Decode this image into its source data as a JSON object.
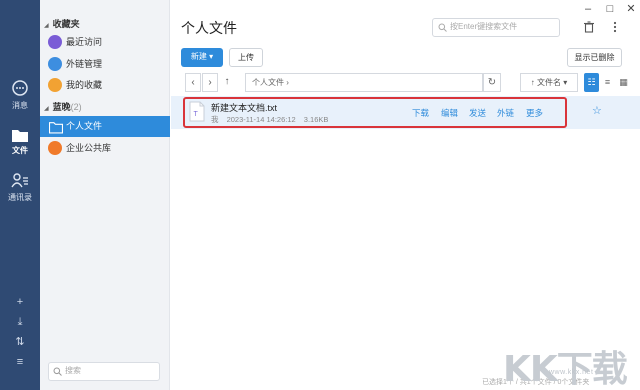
{
  "rail": {
    "items": [
      {
        "label": "消息",
        "icon": "chat-bubble-icon"
      },
      {
        "label": "文件",
        "icon": "folder-icon",
        "active": true
      },
      {
        "label": "通讯录",
        "icon": "contacts-icon"
      }
    ],
    "bottom_icons": [
      "plus-icon",
      "download-icon",
      "transfer-icon",
      "menu-icon"
    ]
  },
  "sidebar": {
    "favorites": {
      "title": "收藏夹",
      "items": [
        {
          "label": "最近访问",
          "icon": "recent-icon",
          "color": "#7a5cd6"
        },
        {
          "label": "外链管理",
          "icon": "link-icon",
          "color": "#3d8ee0"
        },
        {
          "label": "我的收藏",
          "icon": "star-icon",
          "color": "#f2a233"
        }
      ]
    },
    "group": {
      "title": "蓝晚",
      "count": "(2)",
      "items": [
        {
          "label": "个人文件",
          "icon": "personal-folder-icon",
          "active": true
        },
        {
          "label": "企业公共库",
          "icon": "enterprise-library-icon",
          "color": "#f07a2a"
        }
      ]
    },
    "search_placeholder": "搜索"
  },
  "main": {
    "title": "个人文件",
    "search_placeholder": "按Enter键搜索文件",
    "toolbar": {
      "new_label": "新建",
      "upload_label": "上传",
      "show_deleted_label": "显示已删除"
    },
    "path": {
      "current": "个人文件",
      "sort_label": "文件名"
    },
    "files": [
      {
        "name": "新建文本文档.txt",
        "owner": "我",
        "date": "2023-11-14 14:26:12",
        "size": "3.16KB",
        "actions": [
          "下载",
          "编辑",
          "发送",
          "外链",
          "更多"
        ]
      }
    ],
    "status": "已选择1个 / 共1个文件 / 0个文件夹",
    "accent_color": "#2e8bdb",
    "highlight_color": "#d9343a"
  },
  "watermark": {
    "text": "KK下载",
    "url": "www.kkx.net"
  }
}
